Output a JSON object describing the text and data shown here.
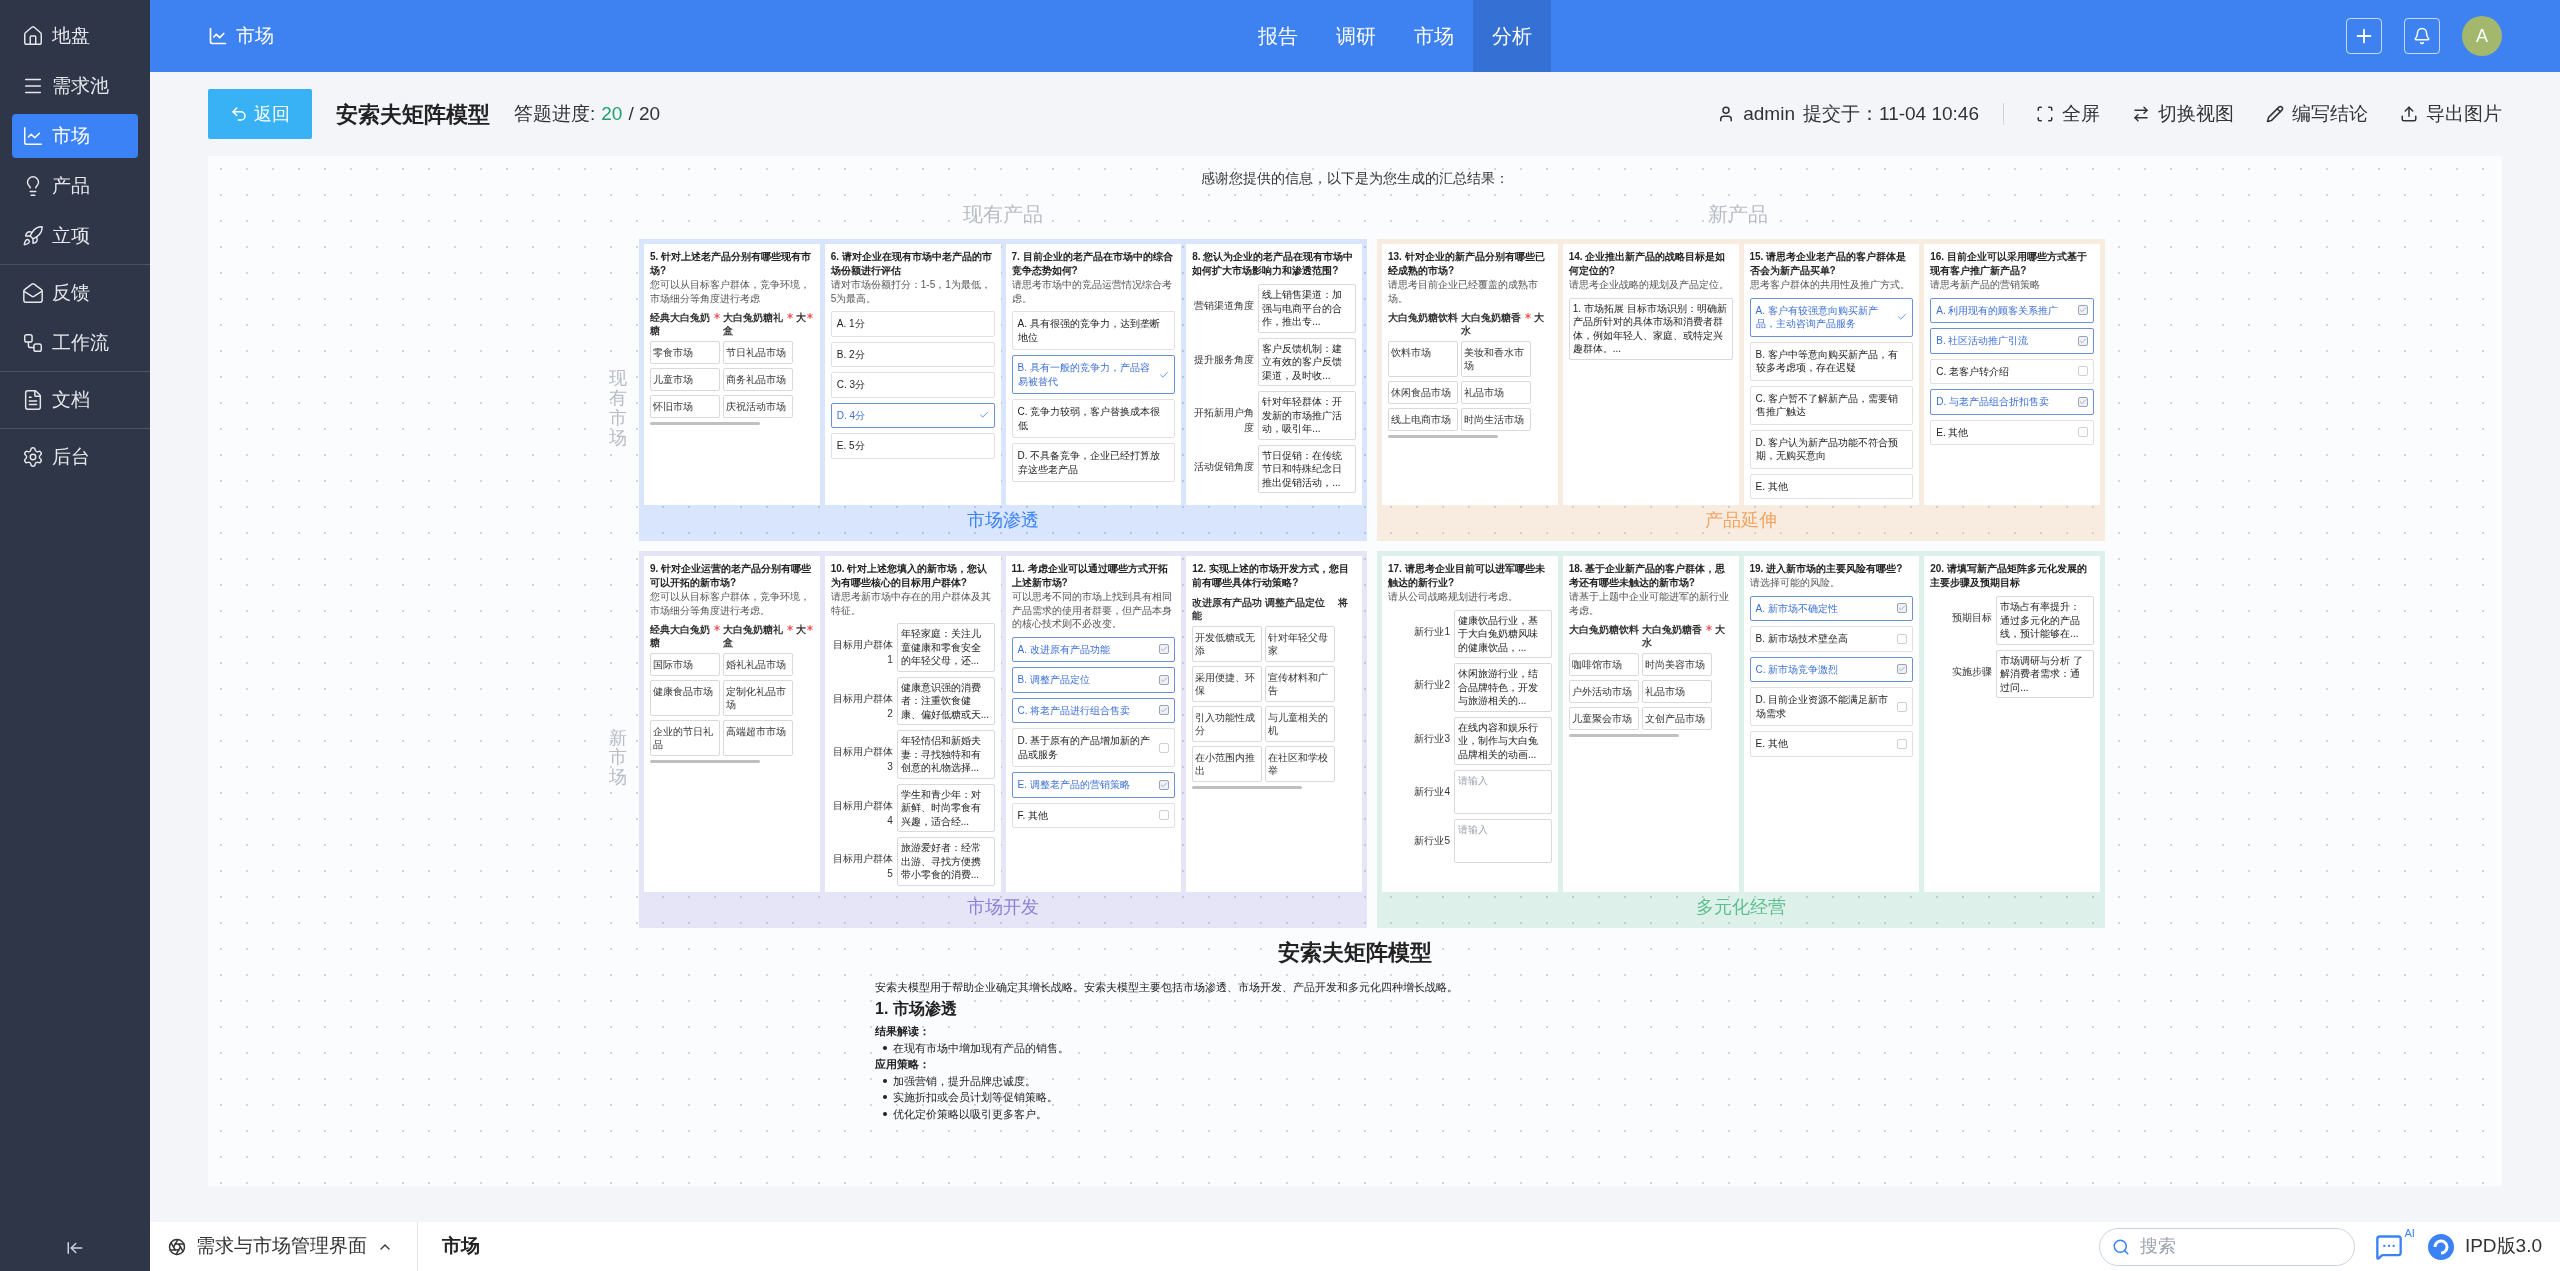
{
  "sidebar": {
    "groups": [
      {
        "items": [
          {
            "label": "地盘",
            "selected": false
          },
          {
            "label": "需求池",
            "selected": false
          },
          {
            "label": "市场",
            "selected": true
          },
          {
            "label": "产品",
            "selected": false
          },
          {
            "label": "立项",
            "selected": false
          }
        ]
      },
      {
        "items": [
          {
            "label": "反馈",
            "selected": false
          },
          {
            "label": "工作流",
            "selected": false
          }
        ]
      },
      {
        "items": [
          {
            "label": "文档",
            "selected": false
          }
        ]
      },
      {
        "items": [
          {
            "label": "后台",
            "selected": false
          }
        ]
      }
    ]
  },
  "topbar": {
    "title": "市场",
    "nav": [
      {
        "label": "报告",
        "selected": false
      },
      {
        "label": "调研",
        "selected": false
      },
      {
        "label": "市场",
        "selected": false
      },
      {
        "label": "分析",
        "selected": true
      }
    ],
    "avatar": "A"
  },
  "header": {
    "back": "返回",
    "title": "安索夫矩阵模型",
    "progress_label": "答题进度:",
    "progress_done": "20",
    "progress_total": "/ 20",
    "user": "admin",
    "submitted": "提交于：11-04 10:46",
    "actions": [
      "全屏",
      "切换视图",
      "编写结论",
      "导出图片"
    ]
  },
  "summary": "感谢您提供的信息，以下是为您生成的汇总结果：",
  "column_labels": [
    "现有产品",
    "新产品"
  ],
  "row_labels": [
    "现有市场",
    "新市场"
  ],
  "quadrants": [
    {
      "title": "市场渗透",
      "color": "#3b82f6",
      "cards": [
        {
          "kind": "table",
          "question": "5. 针对上述老产品分别有哪些现有市场?",
          "hint": "您可以从目标客户群体，竞争环境，市场细分等角度进行考虑",
          "headers": [
            {
              "text": "经典大白兔奶糖",
              "required": true
            },
            {
              "text": "大白兔奶糖礼盒",
              "required": true
            },
            {
              "text": "大",
              "required": true
            }
          ],
          "rows": [
            [
              "零食市场",
              "节日礼品市场"
            ],
            [
              "儿童市场",
              "商务礼品市场"
            ],
            [
              "怀旧市场",
              "庆祝活动市场"
            ]
          ]
        },
        {
          "kind": "choice",
          "question": "6. 请对企业在现有市场中老产品的市场份额进行评估",
          "hint": "请对市场份额打分：1-5，1为最低，5为最高。",
          "options": [
            {
              "text": "A. 1分",
              "selected": false
            },
            {
              "text": "B. 2分",
              "selected": false
            },
            {
              "text": "C. 3分",
              "selected": false
            },
            {
              "text": "D. 4分",
              "selected": true
            },
            {
              "text": "E. 5分",
              "selected": false
            }
          ]
        },
        {
          "kind": "choice",
          "question": "7. 目前企业的老产品在市场中的综合竞争态势如何?",
          "hint": "请思考市场中的竞品运营情况综合考虑。",
          "options": [
            {
              "text": "A. 具有很强的竞争力，达到垄断地位",
              "selected": false
            },
            {
              "text": "B. 具有一般的竞争力，产品容易被替代",
              "selected": true
            },
            {
              "text": "C. 竞争力较弱，客户替换成本很低",
              "selected": false
            },
            {
              "text": "D. 不具备竞争，企业已经打算放弃这些老产品",
              "selected": false
            }
          ]
        },
        {
          "kind": "fields",
          "question": "8. 您认为企业的老产品在现有市场中如何扩大市场影响力和渗透范围?",
          "fields": [
            {
              "label": "营销渠道角度",
              "value": "线上销售渠道：加强与电商平台的合作，推出专..."
            },
            {
              "label": "提升服务角度",
              "value": "客户反馈机制：建立有效的客户反馈渠道，及时收..."
            },
            {
              "label": "开拓新用户角度",
              "value": "针对年轻群体：开发新的市场推广活动，吸引年..."
            },
            {
              "label": "活动促销角度",
              "value": "节日促销：在传统节日和特殊纪念日推出促销活动，..."
            }
          ]
        }
      ]
    },
    {
      "title": "产品延伸",
      "color": "#f0a460",
      "cards": [
        {
          "kind": "table",
          "question": "13. 针对企业的新产品分别有哪些已经成熟的市场?",
          "hint": "请思考目前企业已经覆盖的成熟市场。",
          "headers": [
            {
              "text": "大白兔奶糖饮料",
              "required": false
            },
            {
              "text": "大白兔奶糖香水",
              "required": true
            },
            {
              "text": "大",
              "required": false
            }
          ],
          "rows": [
            [
              "饮料市场",
              "美妆和香水市场"
            ],
            [
              "休闲食品市场",
              "礼品市场"
            ],
            [
              "线上电商市场",
              "时尚生活市场"
            ]
          ]
        },
        {
          "kind": "fields",
          "question": "14. 企业推出新产品的战略目标是如何定位的?",
          "hint": "请思考企业战略的规划及产品定位。",
          "fields": [
            {
              "value": "1. 市场拓展 目标市场识别：明确新产品所针对的具体市场和消费者群体，例如年轻人、家庭、或特定兴趣群体。..."
            }
          ]
        },
        {
          "kind": "choice",
          "question": "15. 请思考企业老产品的客户群体是否会为新产品买单?",
          "hint": "思考客户群体的共用性及推广方式。",
          "options": [
            {
              "text": "A. 客户有较强意向购买新产品，主动咨询产品服务",
              "selected": true
            },
            {
              "text": "B. 客户中等意向购买新产品，有较多考虑项，存在迟疑",
              "selected": false
            },
            {
              "text": "C. 客户暂不了解新产品，需要销售推广触达",
              "selected": false
            },
            {
              "text": "D. 客户认为新产品功能不符合预期，无购买意向",
              "selected": false
            },
            {
              "text": "E. 其他",
              "selected": false
            }
          ]
        },
        {
          "kind": "checkbox",
          "question": "16. 目前企业可以采用哪些方式基于现有客户推广新产品?",
          "hint": "请思考新产品的营销策略",
          "options": [
            {
              "text": "A. 利用现有的顾客关系推广",
              "checked": true
            },
            {
              "text": "B. 社区活动推广引流",
              "checked": true
            },
            {
              "text": "C. 老客户转介绍",
              "checked": false
            },
            {
              "text": "D. 与老产品组合折扣售卖",
              "checked": true
            },
            {
              "text": "E. 其他",
              "checked": false
            }
          ]
        }
      ]
    },
    {
      "title": "市场开发",
      "color": "#8b7fd6",
      "cards": [
        {
          "kind": "table",
          "question": "9. 针对企业运营的老产品分别有哪些可以开拓的新市场?",
          "hint": "您可以从目标客户群体，竞争环境，市场细分等角度进行考虑。",
          "headers": [
            {
              "text": "经典大白兔奶糖",
              "required": true
            },
            {
              "text": "大白兔奶糖礼盒",
              "required": true
            },
            {
              "text": "大",
              "required": true
            }
          ],
          "rows": [
            [
              "国际市场",
              "婚礼礼品市场"
            ],
            [
              "健康食品市场",
              "定制化礼品市场"
            ],
            [
              "企业的节日礼品",
              "高端超市市场"
            ]
          ]
        },
        {
          "kind": "fields",
          "question": "10. 针对上述您填入的新市场，您认为有哪些核心的目标用户群体?",
          "hint": "请思考新市场中存在的用户群体及其特征。",
          "fields": [
            {
              "label": "目标用户群体1",
              "value": "年轻家庭：关注儿童健康和零食安全的年轻父母，还..."
            },
            {
              "label": "目标用户群体2",
              "value": "健康意识强的消费者：注重饮食健康、偏好低糖或天..."
            },
            {
              "label": "目标用户群体3",
              "value": "年轻情侣和新婚夫妻：寻找独特和有创意的礼物选择..."
            },
            {
              "label": "目标用户群体4",
              "value": "学生和青少年：对新鲜、时尚零食有兴趣，适合经..."
            },
            {
              "label": "目标用户群体5",
              "value": "旅游爱好者：经常出游、寻找方便携带小零食的消费..."
            }
          ]
        },
        {
          "kind": "checkbox",
          "question": "11. 考虑企业可以通过哪些方式开拓上述新市场?",
          "hint": "可以思考不同的市场上找到具有相同产品需求的使用者群要，但产品本身的核心技术则不必改变。",
          "options": [
            {
              "text": "A. 改进原有产品功能",
              "checked": true
            },
            {
              "text": "B. 调整产品定位",
              "checked": true
            },
            {
              "text": "C. 将老产品进行组合售卖",
              "checked": true
            },
            {
              "text": "D. 基于原有的产品增加新的产品或服务",
              "checked": false
            },
            {
              "text": "E. 调整老产品的营销策略",
              "checked": true
            },
            {
              "text": "F. 其他",
              "checked": false
            }
          ]
        },
        {
          "kind": "table",
          "question": "12. 实现上述的市场开发方式，您目前有哪些具体行动策略?",
          "headers": [
            {
              "text": "改进原有产品功能",
              "required": false
            },
            {
              "text": "调整产品定位",
              "required": false
            },
            {
              "text": "将",
              "required": false
            }
          ],
          "rows": [
            [
              "开发低糖或无添",
              "针对年轻父母家"
            ],
            [
              "采用便捷、环保",
              "宣传材料和广告"
            ],
            [
              "引入功能性成分",
              "与儿童相关的机"
            ],
            [
              "在小范围内推出",
              "在社区和学校举"
            ]
          ]
        }
      ]
    },
    {
      "title": "多元化经营",
      "color": "#5cbf8e",
      "cards": [
        {
          "kind": "fields",
          "question": "17. 请思考企业目前可以进军哪些未触达的新行业?",
          "hint": "请从公司战略规划进行考虑。",
          "fields": [
            {
              "label": "新行业1",
              "value": "健康饮品行业，基于大白兔奶糖风味的健康饮品，..."
            },
            {
              "label": "新行业2",
              "value": "休闲旅游行业，结合品牌特色，开发与旅游相关的..."
            },
            {
              "label": "新行业3",
              "value": "在线内容和娱乐行业，制作与大白兔品牌相关的动画..."
            },
            {
              "label": "新行业4",
              "placeholder": "请输入"
            },
            {
              "label": "新行业5",
              "placeholder": "请输入"
            }
          ]
        },
        {
          "kind": "table",
          "question": "18. 基于企业新产品的客户群体，思考还有哪些未触达的新市场?",
          "hint": "请基于上题中企业可能进军的新行业考虑。",
          "headers": [
            {
              "text": "大白兔奶糖饮料",
              "required": false
            },
            {
              "text": "大白兔奶糖香水",
              "required": true
            },
            {
              "text": "大",
              "required": false
            }
          ],
          "rows": [
            [
              "咖啡馆市场",
              "时尚美容市场"
            ],
            [
              "户外活动市场",
              "礼品市场"
            ],
            [
              "儿童聚会市场",
              "文创产品市场"
            ]
          ]
        },
        {
          "kind": "checkbox",
          "question": "19. 进入新市场的主要风险有哪些?",
          "hint": "请选择可能的风险。",
          "options": [
            {
              "text": "A. 新市场不确定性",
              "checked": true
            },
            {
              "text": "B. 新市场技术壁垒高",
              "checked": false
            },
            {
              "text": "C. 新市场竞争激烈",
              "checked": true
            },
            {
              "text": "D. 目前企业资源不能满足新市场需求",
              "checked": false
            },
            {
              "text": "E. 其他",
              "checked": false
            }
          ]
        },
        {
          "kind": "fields",
          "question": "20. 请填写新产品矩阵多元化发展的主要步骤及预期目标",
          "fields": [
            {
              "label": "预期目标",
              "value": "市场占有率提升：通过多元化的产品线，预计能够在..."
            },
            {
              "label": "实施步骤",
              "value": "市场调研与分析 了解消费者需求：通过问..."
            }
          ]
        }
      ]
    }
  ],
  "report": {
    "title": "安索夫矩阵模型",
    "intro": "安索夫模型用于帮助企业确定其增长战略。安索夫模型主要包括市场渗透、市场开发、产品开发和多元化四种增长战略。",
    "section": "1. 市场渗透",
    "blocks": [
      {
        "label": "结果解读：",
        "bullets": [
          "在现有市场中增加现有产品的销售。"
        ]
      },
      {
        "label": "应用策略：",
        "bullets": [
          "加强营销，提升品牌忠诚度。",
          "实施折扣或会员计划等促销策略。",
          "优化定价策略以吸引更多客户。"
        ]
      }
    ]
  },
  "footer": {
    "breadcrumb": [
      "需求与市场管理界面",
      "市场"
    ],
    "search": {
      "placeholder": "搜索"
    },
    "badge": "AI",
    "version": "IPD版3.0"
  }
}
